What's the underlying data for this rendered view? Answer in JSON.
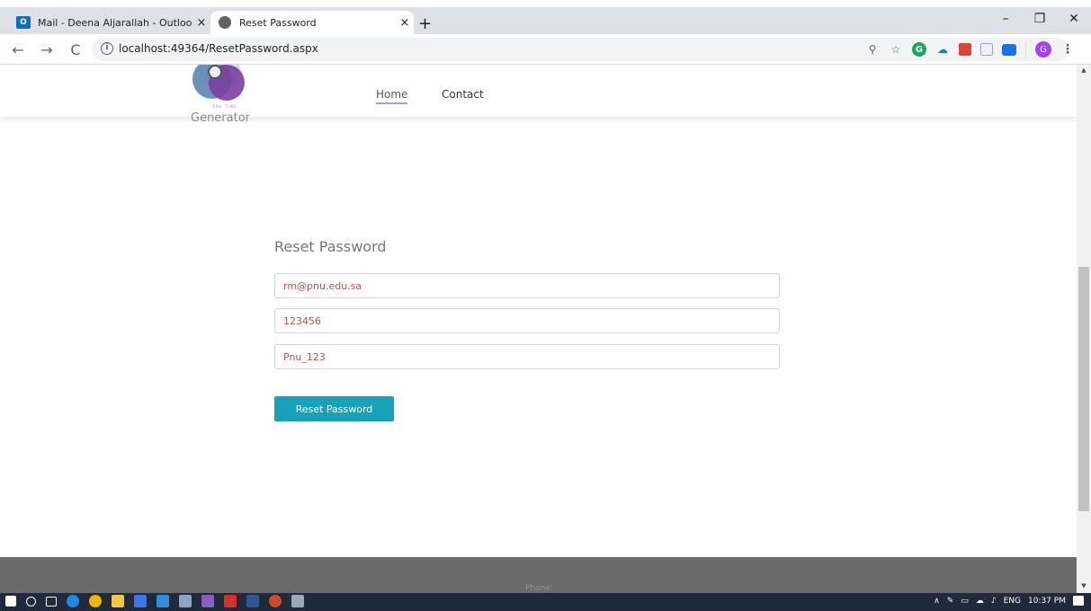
{
  "browser": {
    "tabs": [
      {
        "title": "Mail - Deena Aljarallah - Outlook",
        "close": "×",
        "active": false
      },
      {
        "title": "Reset Password",
        "close": "×",
        "active": true
      }
    ],
    "new_tab": "+",
    "window_controls": {
      "minimize": "–",
      "maximize": "❐",
      "close": "✕"
    },
    "nav": {
      "back": "←",
      "forward": "→",
      "reload": "C"
    },
    "url": "localhost:49364/ResetPassword.aspx",
    "extensions": {
      "zoom": "⚲",
      "star": "☆",
      "grammarly": "G",
      "profile": "G",
      "menu": "⋮"
    }
  },
  "site": {
    "logo_text": "Generator",
    "logo_tiny": "ONE TIME",
    "nav": {
      "home": "Home",
      "contact": "Contact"
    }
  },
  "form": {
    "title": "Reset Password",
    "fields": {
      "email": "rm@pnu.edu.sa",
      "code": "123456",
      "password": "Pnu_123"
    },
    "submit_label": "Reset Password"
  },
  "footer": {
    "phone": "Phone:"
  },
  "taskbar": {
    "tray": {
      "arrow": "∧",
      "lang": "ENG",
      "time": "10:37 PM"
    }
  },
  "scrollbar": {
    "up": "▲",
    "down": "▼"
  }
}
